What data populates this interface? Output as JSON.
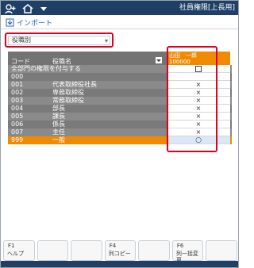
{
  "topbar": {
    "role_label": "社員権限[上長用]",
    "icons": [
      "user-plus-icon",
      "home-icon",
      "menu-caret-icon"
    ]
  },
  "import": {
    "label": "インポート",
    "icon": "import-icon"
  },
  "select": {
    "value": "役職別"
  },
  "table": {
    "headers": {
      "code": "コード",
      "name": "役職名"
    },
    "user": {
      "name": "山田　一郎",
      "code": "100000"
    },
    "all_row": {
      "label": "全部門の権限を付与する",
      "mark": "checkbox"
    },
    "rows": [
      {
        "code": "000",
        "name": "",
        "mark": ""
      },
      {
        "code": "001",
        "name": "代表取締役社長",
        "mark": "×"
      },
      {
        "code": "002",
        "name": "専務取締役",
        "mark": "×"
      },
      {
        "code": "003",
        "name": "常務取締役",
        "mark": "×"
      },
      {
        "code": "004",
        "name": "部長",
        "mark": "×"
      },
      {
        "code": "005",
        "name": "課長",
        "mark": "×"
      },
      {
        "code": "006",
        "name": "係長",
        "mark": "×"
      },
      {
        "code": "007",
        "name": "主任",
        "mark": "×"
      },
      {
        "code": "999",
        "name": "一般",
        "mark": "○",
        "selected": true
      }
    ]
  },
  "fkeys": [
    {
      "key": "F1",
      "label": "ヘルプ"
    },
    {
      "key": "",
      "label": ""
    },
    {
      "key": "",
      "label": ""
    },
    {
      "key": "F4",
      "label": "列コピー"
    },
    {
      "key": "",
      "label": ""
    },
    {
      "key": "F6",
      "label": "列一括変更"
    },
    {
      "key": "",
      "label": ""
    }
  ],
  "colors": {
    "navy": "#1f3f66",
    "accent": "#f08a00",
    "highlight": "#e0001b"
  }
}
